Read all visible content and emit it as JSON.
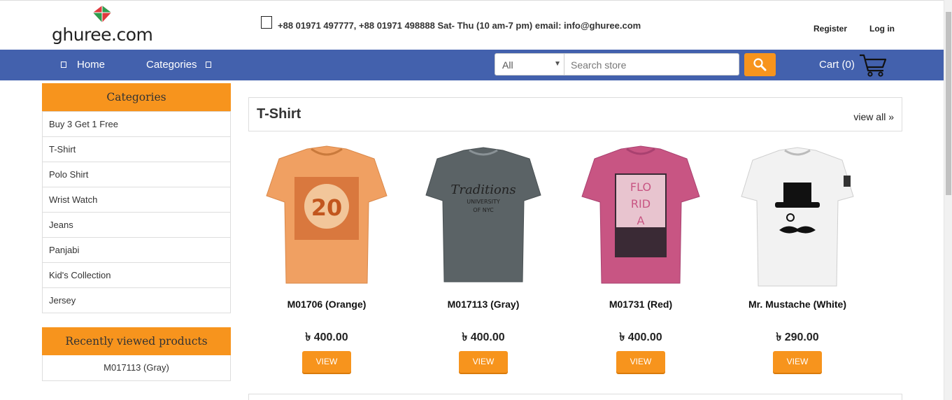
{
  "header": {
    "logo_text": "ghuree.com",
    "contact": "+88 01971 497777, +88 01971 498888 Sat- Thu (10 am-7 pm) email: info@ghuree.com",
    "register": "Register",
    "login": "Log in"
  },
  "nav": {
    "home": "Home",
    "categories": "Categories",
    "search_category": "All",
    "search_placeholder": "Search store",
    "cart": "Cart (0)"
  },
  "sidebar": {
    "categories_title": "Categories",
    "categories": [
      "Buy 3 Get 1 Free",
      "T-Shirt",
      "Polo Shirt",
      "Wrist Watch",
      "Jeans",
      "Panjabi",
      "Kid's Collection",
      "Jersey"
    ],
    "recent_title": "Recently viewed products",
    "recent": [
      "M017113 (Gray)"
    ]
  },
  "main": {
    "section_title": "T-Shirt",
    "view_all": "view all »",
    "products": [
      {
        "name": "M01706 (Orange)",
        "price": "৳ 400.00",
        "button": "VIEW",
        "color": "#f0a062",
        "print": "20"
      },
      {
        "name": "M017113 (Gray)",
        "price": "৳ 400.00",
        "button": "VIEW",
        "color": "#5b6366",
        "print": "Traditions"
      },
      {
        "name": "M01731 (Red)",
        "price": "৳ 400.00",
        "button": "VIEW",
        "color": "#c85583",
        "print": "FLORIDA"
      },
      {
        "name": "Mr. Mustache (White)",
        "price": "৳ 290.00",
        "button": "VIEW",
        "color": "#f2f2f2",
        "print": "mustache"
      }
    ]
  },
  "colors": {
    "nav_blue": "#4361ad",
    "accent_orange": "#f7941d"
  }
}
